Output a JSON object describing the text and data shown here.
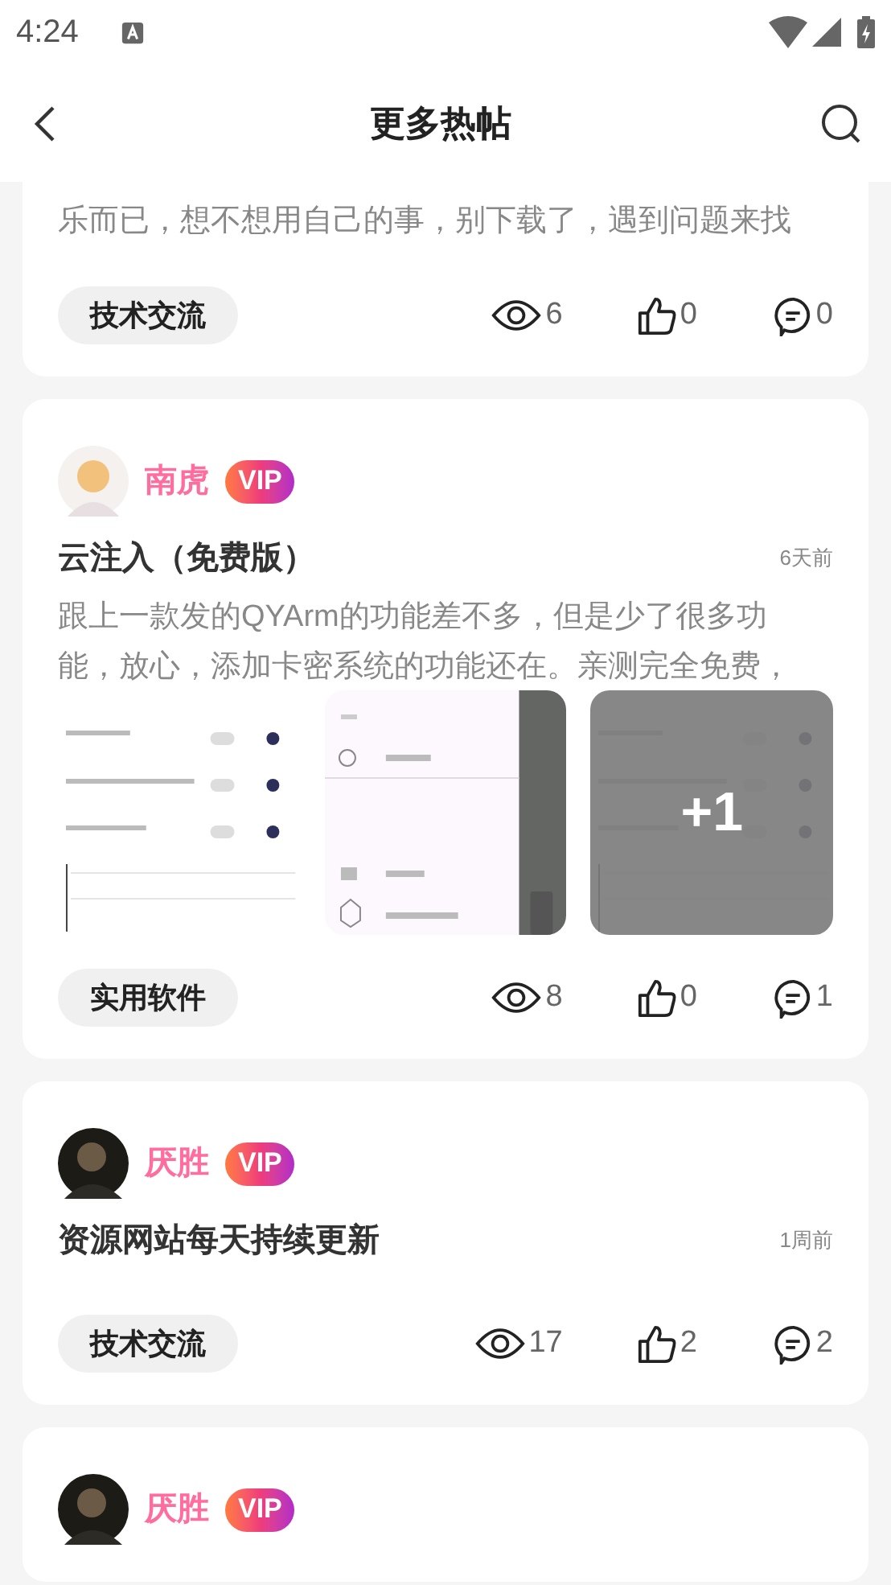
{
  "status_bar": {
    "time": "4:24"
  },
  "header": {
    "title": "更多热帖"
  },
  "posts": [
    {
      "description": [
        "乐而已，想不想用自己的事，别下载了，遇到问题来找"
      ],
      "tag": "技术交流",
      "views": "6",
      "likes": "0",
      "comments": "0"
    },
    {
      "author": "南虎",
      "badge": "VIP",
      "title": "云注入（免费版）",
      "time": "6天前",
      "description": [
        "跟上一款发的QYArm的功能差不多，但是少了很多功",
        "能，放心，添加卡密系统的功能还在。亲测完全免费，"
      ],
      "images": [
        {
          "kind": "picture"
        },
        {
          "kind": "picture"
        },
        {
          "kind": "picture",
          "more": "+1"
        }
      ],
      "tag": "实用软件",
      "views": "8",
      "likes": "0",
      "comments": "1"
    },
    {
      "author": "厌胜",
      "badge": "VIP",
      "title": "资源网站每天持续更新",
      "time": "1周前",
      "tag": "技术交流",
      "views": "17",
      "likes": "2",
      "comments": "2"
    },
    {
      "author": "厌胜",
      "badge": "VIP"
    }
  ]
}
